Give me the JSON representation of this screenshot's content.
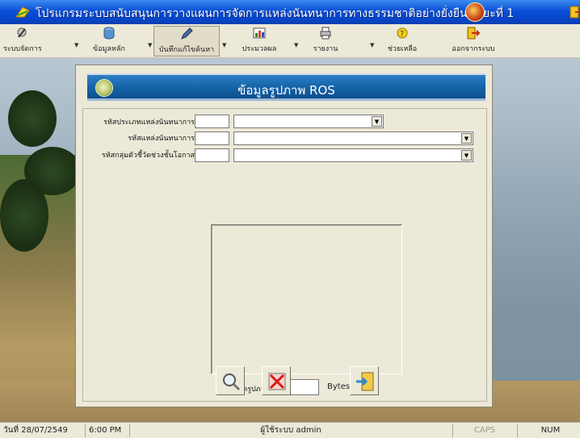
{
  "window": {
    "title": "โปรแกรมระบบสนับสนุนการวางแผนการจัดการแหล่งนันทนาการทางธรรมชาติอย่างยั่งยืน ระยะที่ 1"
  },
  "toolbar": {
    "items": [
      {
        "label": "ระบบจัดการ",
        "icon": "system-icon"
      },
      {
        "label": "ข้อมูลหลัก",
        "icon": "data-icon"
      },
      {
        "label": "บันทึกแก้ไขค้นหา",
        "icon": "edit-icon"
      },
      {
        "label": "ประมวลผล",
        "icon": "process-icon"
      },
      {
        "label": "รายงาน",
        "icon": "report-icon"
      },
      {
        "label": "ช่วยเหลือ",
        "icon": "help-icon"
      },
      {
        "label": "ออกจากระบบ",
        "icon": "logout-icon"
      }
    ]
  },
  "form": {
    "title": "ข้อมูลรูปภาพ ROS",
    "fields": [
      {
        "label": "รหัสประเภทแหล่งนันทนาการ",
        "code_value": "",
        "select_value": ""
      },
      {
        "label": "รหัสแหล่งนันทนาการ",
        "code_value": "",
        "select_value": ""
      },
      {
        "label": "รหัสกลุ่มตัวชี้วัดช่วงชั้นโอกาส",
        "code_value": "",
        "select_value": ""
      }
    ],
    "image_size_label": "ขนาดรูปภาพ",
    "image_size_value": "",
    "image_size_unit": "Bytes",
    "buttons": {
      "browse": "magnifier-icon",
      "delete": "delete-icon",
      "exit": "exit-icon"
    }
  },
  "statusbar": {
    "date": "วันที่ 28/07/2549",
    "time": "6:00 PM",
    "user": "ผู้ใช้ระบบ admin",
    "caps": "CAPS",
    "num": "NUM"
  },
  "colors": {
    "titlebar": "#0a4fd6",
    "form_header": "#1462a6",
    "panel": "#ece9d8"
  }
}
